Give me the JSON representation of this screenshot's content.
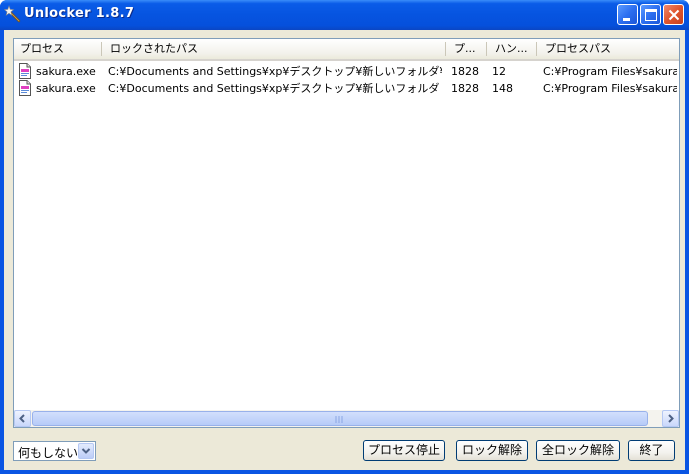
{
  "window": {
    "title": "Unlocker 1.8.7"
  },
  "columns": [
    "プロセス",
    "ロックされたパス",
    "プ...",
    "ハン...",
    "プロセスパス"
  ],
  "rows": [
    {
      "process": "sakura.exe",
      "locked_path": "C:¥Documents and Settings¥xp¥デスクトップ¥新しいフォルダ¥新規...",
      "pid": "1828",
      "handle": "12",
      "process_path": "C:¥Program Files¥sakura¥..."
    },
    {
      "process": "sakura.exe",
      "locked_path": "C:¥Documents and Settings¥xp¥デスクトップ¥新しいフォルダ",
      "pid": "1828",
      "handle": "148",
      "process_path": "C:¥Program Files¥sakura¥..."
    }
  ],
  "action_select": {
    "value": "何もしない"
  },
  "buttons": {
    "kill_process": "プロセス停止",
    "unlock": "ロック解除",
    "unlock_all": "全ロック解除",
    "quit": "終了"
  },
  "icons": {
    "app": "unlocker-wand-icon",
    "row": "document-icon",
    "minimize": "minimize-icon",
    "maximize": "maximize-icon",
    "close": "close-icon"
  },
  "colors": {
    "titlebar": "#0654e0",
    "client": "#ece9d8",
    "border": "#7f9db9"
  }
}
